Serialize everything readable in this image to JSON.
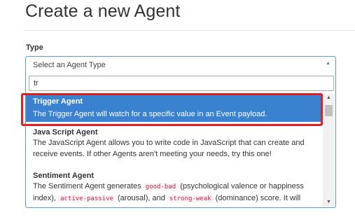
{
  "page": {
    "title": "Create a new Agent"
  },
  "form": {
    "type_label": "Type",
    "select_placeholder": "Select an Agent Type",
    "search_value": "tr"
  },
  "options": [
    {
      "name": "Trigger Agent",
      "desc": "The Trigger Agent will watch for a specific value in an Event payload."
    },
    {
      "name": "Java Script Agent",
      "desc_line1": "The JavaScript Agent allows you to write code in JavaScript that can create and",
      "desc_line2": "receive events. If other Agents aren't meeting your needs, try this one!"
    },
    {
      "name": "Sentiment Agent",
      "line1_pre": "The Sentiment Agent generates ",
      "line1_code": "good-bad",
      "line1_post": " (psychological valence or happiness",
      "line2_pre": "index), ",
      "line2_code1": "active-passive",
      "line2_mid": " (arousal), and ",
      "line2_code2": "strong-weak",
      "line2_post": " (dominance) score. It will"
    }
  ],
  "colors": {
    "highlight": "#3a82cf",
    "focus_border": "#5b9bd5",
    "annotation": "#e02020",
    "code_text": "#c7254e"
  },
  "icons": {
    "select_arrow": "triangle-up-icon",
    "scroll_up": "triangle-up-icon",
    "scroll_down": "triangle-down-icon"
  }
}
